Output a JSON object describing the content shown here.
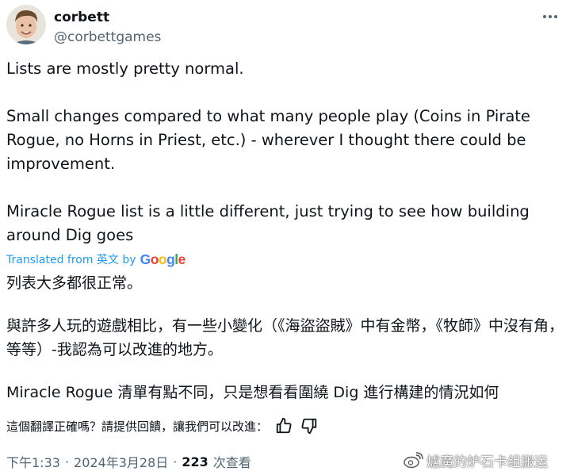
{
  "author": {
    "name": "corbett",
    "handle": "@corbettgames",
    "avatar_icon": "user-avatar-photo"
  },
  "tweet": {
    "lines_en": [
      "Lists are mostly pretty normal.",
      "Small changes compared to what many people play (Coins in Pirate Rogue, no Horns in Priest, etc.) - wherever I thought there could be improvement.",
      "Miracle Rogue list is a little different, just trying to see how building around Dig goes"
    ],
    "translated_label": "Translated from 英文 by",
    "translator": "Google",
    "lines_zh": [
      "列表大多都很正常。",
      "與許多人玩的遊戲相比，有一些小變化（《海盜盜賊》中有金幣，《牧師》中沒有角，等等）-我認為可以改進的地方。",
      "Miracle Rogue 清單有點不同，只是想看看圍繞 Dig 進行構建的情況如何"
    ]
  },
  "feedback": {
    "prompt": "這個翻譯正確嗎？請提供回饋，讓我們可以改進：",
    "like_icon": "thumbs-up-icon",
    "dislike_icon": "thumbs-down-icon"
  },
  "meta": {
    "time": "下午1:33",
    "date": "2024年3月28日",
    "views_count": "223",
    "views_label": "次查看"
  },
  "watermark": {
    "text": "爐魔的炉石卡组搬运"
  },
  "colors": {
    "text": "#0f1419",
    "secondary": "#536471",
    "link": "#1d9bf0"
  }
}
